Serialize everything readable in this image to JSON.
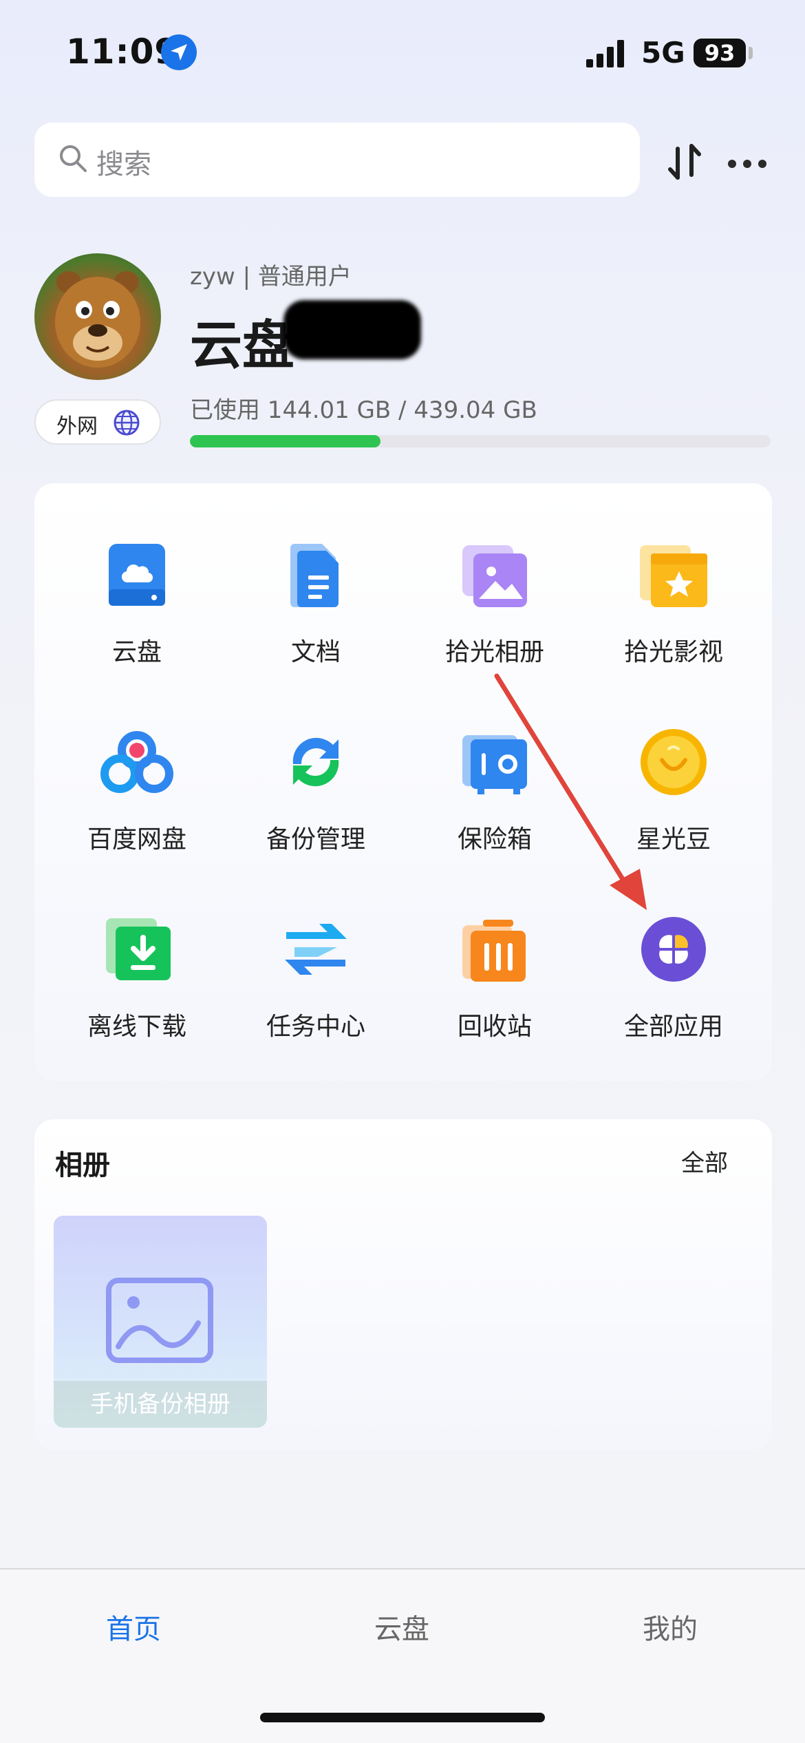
{
  "status_bar": {
    "time": "11:09",
    "network": "5G",
    "battery": "93"
  },
  "search": {
    "placeholder": "搜索"
  },
  "profile": {
    "username": "zyw",
    "role": "普通用户",
    "meta": "zyw | 普通用户",
    "drive_title": "云盘",
    "network_mode": "外网",
    "storage_text": "已使用 144.01 GB / 439.04 GB",
    "storage_used_fraction": 0.328
  },
  "apps": [
    {
      "label": "云盘",
      "icon": "cloud-drive-icon"
    },
    {
      "label": "文档",
      "icon": "document-icon"
    },
    {
      "label": "拾光相册",
      "icon": "photo-album-icon"
    },
    {
      "label": "拾光影视",
      "icon": "video-star-icon"
    },
    {
      "label": "百度网盘",
      "icon": "baidu-netdisk-icon"
    },
    {
      "label": "备份管理",
      "icon": "backup-sync-icon"
    },
    {
      "label": "保险箱",
      "icon": "safe-box-icon"
    },
    {
      "label": "星光豆",
      "icon": "star-bean-coin-icon"
    },
    {
      "label": "离线下载",
      "icon": "offline-download-icon"
    },
    {
      "label": "任务中心",
      "icon": "task-center-icon"
    },
    {
      "label": "回收站",
      "icon": "recycle-bin-icon"
    },
    {
      "label": "全部应用",
      "icon": "all-apps-icon"
    }
  ],
  "album": {
    "title": "相册",
    "all_link": "全部",
    "cards": [
      {
        "caption": "手机备份相册"
      }
    ]
  },
  "bottom_nav": {
    "tabs": [
      {
        "label": "首页",
        "active": true
      },
      {
        "label": "云盘",
        "active": false
      },
      {
        "label": "我的",
        "active": false
      }
    ]
  },
  "colors": {
    "accent": "#1a73e8",
    "storage_fill": "#2fc451",
    "annotation_arrow": "#e0443a"
  }
}
